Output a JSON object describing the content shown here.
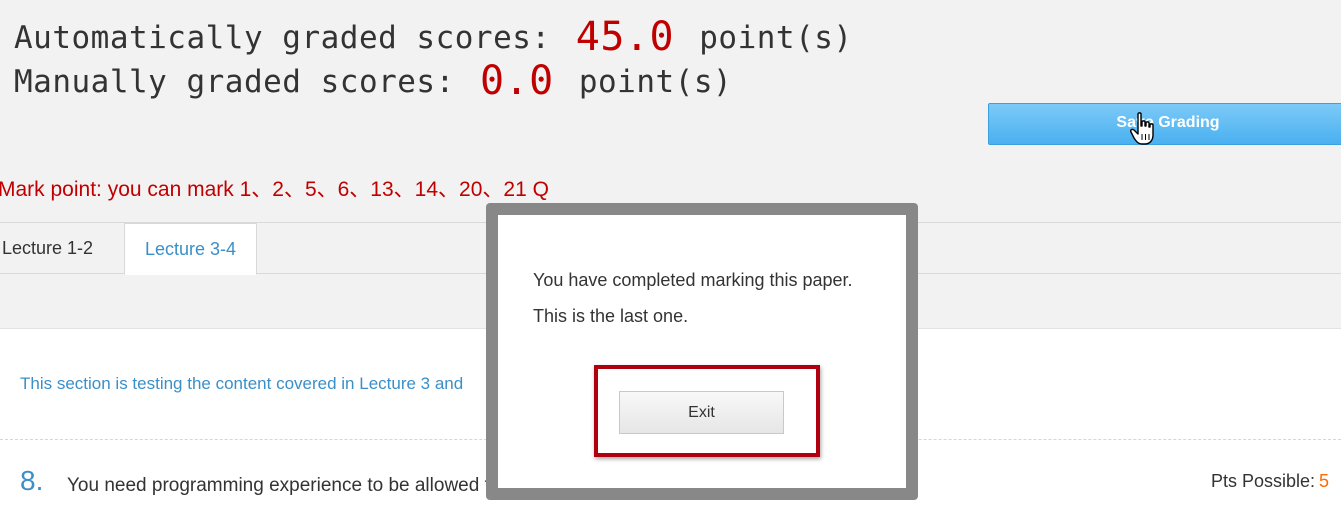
{
  "scores": {
    "auto_label": "Automatically graded scores:",
    "auto_value": "45.0",
    "manual_label": "Manually graded scores:",
    "manual_value": "0.0",
    "unit": "point(s)"
  },
  "save_button": {
    "label": "Save Grading"
  },
  "mark_point": "Mark point: you can mark 1、2、5、6、13、14、20、21 Q",
  "tabs": [
    {
      "label": "Lecture 1-2",
      "active": false
    },
    {
      "label": "Lecture 3-4",
      "active": true
    }
  ],
  "section": {
    "description": "This section is testing the content covered in Lecture 3 and"
  },
  "question": {
    "number": "8.",
    "text": "You need programming experience to be allowed to enroll this course.",
    "pts_label": "Pts Possible:",
    "pts_value": "5"
  },
  "modal": {
    "line1": "You have completed marking this paper.",
    "line2": "This is the last one.",
    "exit_label": "Exit"
  },
  "colors": {
    "accent_red": "#c00000",
    "link_blue": "#3a8fc9",
    "button_blue": "#4ab0f0",
    "pts_orange": "#ff6a00"
  },
  "icons": [
    "hand-pointer-cursor-icon"
  ]
}
